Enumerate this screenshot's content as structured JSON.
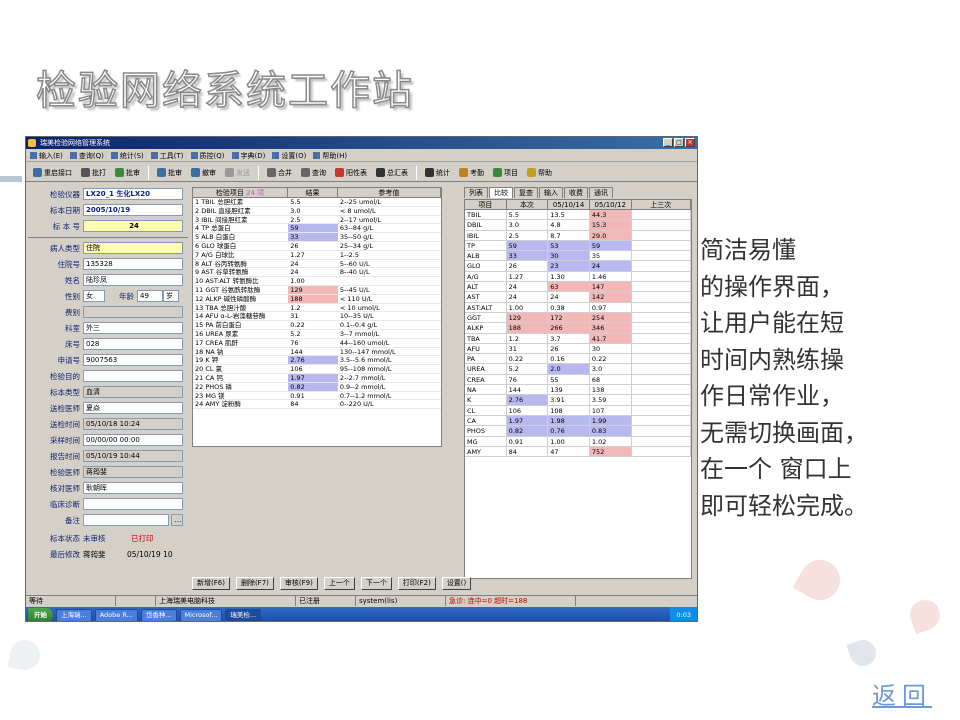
{
  "slide": {
    "title": "检验网络系统工作站",
    "description_lines": [
      "简洁易懂",
      "的操作界面，",
      "让用户能在短",
      "时间内熟练操",
      "作日常作业，",
      "无需切换画面，",
      "在一个 窗口上",
      "即可轻松完成。"
    ],
    "back_link": "返回"
  },
  "window": {
    "title": "瑞美检验网络管理系统",
    "menu": [
      "输入(E)",
      "查询(Q)",
      "统计(S)",
      "工具(T)",
      "质控(Q)",
      "字典(D)",
      "设置(O)",
      "帮助(H)"
    ],
    "toolbar": [
      {
        "label": "重启接口",
        "icon": "restart-icon",
        "color": "#3a6ea5"
      },
      {
        "label": "批打",
        "icon": "print-icon",
        "color": "#555555"
      },
      {
        "label": "批审",
        "icon": "audit-icon",
        "color": "#3a8a3a"
      },
      {
        "label": "批审",
        "icon": "batch-audit-icon",
        "color": "#3a6ea5"
      },
      {
        "label": "撤审",
        "icon": "undo-audit-icon",
        "color": "#3a6ea5"
      },
      {
        "label": "发送",
        "icon": "send-icon",
        "color": "#999999",
        "disabled": true
      },
      {
        "label": "合并",
        "icon": "merge-icon",
        "color": "#666666"
      },
      {
        "label": "查询",
        "icon": "query-icon",
        "color": "#666666"
      },
      {
        "label": "阳性表",
        "icon": "positive-icon",
        "color": "#c0392b"
      },
      {
        "label": "总汇表",
        "icon": "summary-icon",
        "color": "#333333"
      },
      {
        "label": "统计",
        "icon": "stats-icon",
        "color": "#333333"
      },
      {
        "label": "考勤",
        "icon": "attendance-icon",
        "color": "#c08020"
      },
      {
        "label": "项目",
        "icon": "project-icon",
        "color": "#3a8a3a"
      },
      {
        "label": "帮助",
        "icon": "help-icon",
        "color": "#c0a020"
      }
    ],
    "left": {
      "instrument_label": "检验仪器",
      "instrument_value": "LX20_1 生化LX20",
      "date_label": "标本日期",
      "date_value": "2005/10/19",
      "specimen_no_label": "标 本 号",
      "specimen_no_value": "24",
      "patient_type_label": "病人类型",
      "patient_type_value": "住院",
      "admission_label": "住院号",
      "admission_value": "135328",
      "name_label": "姓名",
      "name_value": "陆珍凤",
      "sex_label": "性别",
      "sex_value": "女",
      "age_label": "年龄",
      "age_value": "49",
      "age_unit": "岁",
      "fee_label": "费别",
      "fee_value": "",
      "dept_label": "科室",
      "dept_value": "外三",
      "bed_label": "床号",
      "bed_value": "028",
      "request_label": "申请号",
      "request_value": "9007563",
      "purpose_label": "检验目的",
      "purpose_value": "",
      "sample_type_label": "标本类型",
      "sample_type_value": "血清",
      "doctor_label": "送检医师",
      "doctor_value": "夏焱",
      "send_time_label": "送检时间",
      "send_time_value": "05/10/18 10:24",
      "collect_time_label": "采样时间",
      "collect_time_value": "00/00/00 00:00",
      "report_time_label": "报告时间",
      "report_time_value": "05/10/19 10:44",
      "tester_label": "检验医师",
      "tester_value": "蒋筠斐",
      "checker_label": "核对医师",
      "checker_value": "耿朝晖",
      "diagnosis_label": "临床诊断",
      "diagnosis_value": "",
      "remark_label": "备注",
      "remark_value": "",
      "status_label": "标本状态",
      "status_value": "未审核",
      "status_printed": "已打印",
      "modified_label": "最后修改",
      "modified_by": "蒋筠斐",
      "modified_time": "05/10/19 10"
    },
    "center": {
      "col_item": "检验项目",
      "col_count": "24 项",
      "col_result": "结果",
      "col_ref": "参考值",
      "rows": [
        {
          "n": "1",
          "name": "TBIL 总胆红素",
          "res": "5.5",
          "ref": "2--25 umol/L",
          "hi": ""
        },
        {
          "n": "2",
          "name": "DBIL 直接胆红素",
          "res": "3.0",
          "ref": "< 8 umol/L",
          "hi": ""
        },
        {
          "n": "3",
          "name": "IBIL 间接胆红素",
          "res": "2.5",
          "ref": "2--17 umol/L",
          "hi": ""
        },
        {
          "n": "4",
          "name": "TP 总蛋白",
          "res": "59",
          "ref": "63--84 g/L",
          "hi": "blue"
        },
        {
          "n": "5",
          "name": "ALB 白蛋白",
          "res": "33",
          "ref": "35--50 g/L",
          "hi": "blue"
        },
        {
          "n": "6",
          "name": "GLO 球蛋白",
          "res": "26",
          "ref": "25--34 g/L",
          "hi": ""
        },
        {
          "n": "7",
          "name": "A/G 白球比",
          "res": "1.27",
          "ref": "1--2.5",
          "hi": ""
        },
        {
          "n": "8",
          "name": "ALT 谷丙转氨酶",
          "res": "24",
          "ref": "5--60 U/L",
          "hi": ""
        },
        {
          "n": "9",
          "name": "AST 谷草转氨酶",
          "res": "24",
          "ref": "8--40 U/L",
          "hi": ""
        },
        {
          "n": "10",
          "name": "AST:ALT 转氨酶比",
          "res": "1.00",
          "ref": "",
          "hi": ""
        },
        {
          "n": "11",
          "name": "GGT 谷氨酰转肽酶",
          "res": "129",
          "ref": "5--45 U/L",
          "hi": "red"
        },
        {
          "n": "12",
          "name": "ALKP 碱性磷酸酶",
          "res": "188",
          "ref": "< 110 U/L",
          "hi": "red"
        },
        {
          "n": "13",
          "name": "TBA 总胆汁酸",
          "res": "1.2",
          "ref": "< 10 umol/L",
          "hi": ""
        },
        {
          "n": "14",
          "name": "AFU α-L-岩藻糖苷酶",
          "res": "31",
          "ref": "10--35 U/L",
          "hi": ""
        },
        {
          "n": "15",
          "name": "PA 前白蛋白",
          "res": "0.22",
          "ref": "0.1--0.4 g/L",
          "hi": ""
        },
        {
          "n": "16",
          "name": "UREA 尿素",
          "res": "5.2",
          "ref": "3--7 mmol/L",
          "hi": ""
        },
        {
          "n": "17",
          "name": "CREA 肌酐",
          "res": "76",
          "ref": "44--160 umol/L",
          "hi": ""
        },
        {
          "n": "18",
          "name": "NA 钠",
          "res": "144",
          "ref": "130--147 mmol/L",
          "hi": ""
        },
        {
          "n": "19",
          "name": "K 钾",
          "res": "2.76",
          "ref": "3.5--5.6 mmol/L",
          "hi": "blue"
        },
        {
          "n": "20",
          "name": "CL 氯",
          "res": "106",
          "ref": "95--108 mmol/L",
          "hi": ""
        },
        {
          "n": "21",
          "name": "CA 钙",
          "res": "1.97",
          "ref": "2--2.7 mmol/L",
          "hi": "blue"
        },
        {
          "n": "22",
          "name": "PHOS 磷",
          "res": "0.82",
          "ref": "0.9--2 mmol/L",
          "hi": "blue"
        },
        {
          "n": "23",
          "name": "MG 镁",
          "res": "0.91",
          "ref": "0.7--1.2 mmol/L",
          "hi": ""
        },
        {
          "n": "24",
          "name": "AMY 淀粉酶",
          "res": "84",
          "ref": "0--220 U/L",
          "hi": ""
        }
      ]
    },
    "right": {
      "tabs": [
        "列表",
        "比较",
        "复查",
        "输入",
        "收费",
        "通讯"
      ],
      "active_tab": "比较",
      "headers": [
        "项目",
        "本次",
        "05/10/14",
        "05/10/12",
        "上三次"
      ],
      "rows": [
        {
          "c": [
            "TBIL",
            "5.5",
            "13.5",
            "44.3",
            ""
          ],
          "h": [
            "",
            "",
            "",
            "red",
            ""
          ]
        },
        {
          "c": [
            "DBIL",
            "3.0",
            "4.8",
            "15.3",
            ""
          ],
          "h": [
            "",
            "",
            "",
            "red",
            ""
          ]
        },
        {
          "c": [
            "IBIL",
            "2.5",
            "8.7",
            "29.0",
            ""
          ],
          "h": [
            "",
            "",
            "",
            "red",
            ""
          ]
        },
        {
          "c": [
            "TP",
            "59",
            "53",
            "59",
            ""
          ],
          "h": [
            "",
            "blue",
            "blue",
            "blue",
            ""
          ]
        },
        {
          "c": [
            "ALB",
            "33",
            "30",
            "35",
            ""
          ],
          "h": [
            "",
            "blue",
            "blue",
            "",
            ""
          ]
        },
        {
          "c": [
            "GLO",
            "26",
            "23",
            "24",
            ""
          ],
          "h": [
            "",
            "",
            "blue",
            "blue",
            ""
          ]
        },
        {
          "c": [
            "A/G",
            "1.27",
            "1.30",
            "1.46",
            ""
          ],
          "h": [
            "",
            "",
            "",
            "",
            ""
          ]
        },
        {
          "c": [
            "ALT",
            "24",
            "63",
            "147",
            ""
          ],
          "h": [
            "",
            "",
            "red",
            "red",
            ""
          ]
        },
        {
          "c": [
            "AST",
            "24",
            "24",
            "142",
            ""
          ],
          "h": [
            "",
            "",
            "",
            "red",
            ""
          ]
        },
        {
          "c": [
            "AST:ALT",
            "1.00",
            "0.38",
            "0.97",
            ""
          ],
          "h": [
            "",
            "",
            "",
            "",
            ""
          ]
        },
        {
          "c": [
            "GGT",
            "129",
            "172",
            "254",
            ""
          ],
          "h": [
            "",
            "red",
            "red",
            "red",
            ""
          ]
        },
        {
          "c": [
            "ALKP",
            "188",
            "266",
            "346",
            ""
          ],
          "h": [
            "",
            "red",
            "red",
            "red",
            ""
          ]
        },
        {
          "c": [
            "TBA",
            "1.2",
            "3.7",
            "41.7",
            ""
          ],
          "h": [
            "",
            "",
            "",
            "red",
            ""
          ]
        },
        {
          "c": [
            "AFU",
            "31",
            "26",
            "30",
            ""
          ],
          "h": [
            "",
            "",
            "",
            "",
            ""
          ]
        },
        {
          "c": [
            "PA",
            "0.22",
            "0.16",
            "0.22",
            ""
          ],
          "h": [
            "",
            "",
            "",
            "",
            ""
          ]
        },
        {
          "c": [
            "UREA",
            "5.2",
            "2.0",
            "3.0",
            ""
          ],
          "h": [
            "",
            "",
            "blue",
            "",
            ""
          ]
        },
        {
          "c": [
            "CREA",
            "76",
            "55",
            "68",
            ""
          ],
          "h": [
            "",
            "",
            "",
            "",
            ""
          ]
        },
        {
          "c": [
            "NA",
            "144",
            "139",
            "138",
            ""
          ],
          "h": [
            "",
            "",
            "",
            "",
            ""
          ]
        },
        {
          "c": [
            "K",
            "2.76",
            "3.91",
            "3.59",
            ""
          ],
          "h": [
            "",
            "blue",
            "",
            "",
            ""
          ]
        },
        {
          "c": [
            "CL",
            "106",
            "108",
            "107",
            ""
          ],
          "h": [
            "",
            "",
            "",
            "",
            ""
          ]
        },
        {
          "c": [
            "CA",
            "1.97",
            "1.98",
            "1.99",
            ""
          ],
          "h": [
            "",
            "blue",
            "blue",
            "blue",
            ""
          ]
        },
        {
          "c": [
            "PHOS",
            "0.82",
            "0.76",
            "0.83",
            ""
          ],
          "h": [
            "",
            "blue",
            "blue",
            "blue",
            ""
          ]
        },
        {
          "c": [
            "MG",
            "0.91",
            "1.00",
            "1.02",
            ""
          ],
          "h": [
            "",
            "",
            "",
            "",
            ""
          ]
        },
        {
          "c": [
            "AMY",
            "84",
            "47",
            "752",
            ""
          ],
          "h": [
            "",
            "",
            "",
            "red",
            ""
          ]
        }
      ]
    },
    "buttons": [
      "新增(F6)",
      "删除(F7)",
      "审核(F9)",
      "上一个",
      "下一个",
      "打印(F2)",
      "设置()"
    ],
    "status": [
      "等待",
      "",
      "上海瑞美电脑科技",
      "已注册",
      "system(lis)",
      "急诊: 连中=0 超时=188"
    ],
    "taskbar": {
      "start": "开始",
      "items": [
        "上海瑞...",
        "Adobe R...",
        "岱香种...",
        "Microsof...",
        "瑞美检..."
      ],
      "clock": "0:03"
    }
  }
}
